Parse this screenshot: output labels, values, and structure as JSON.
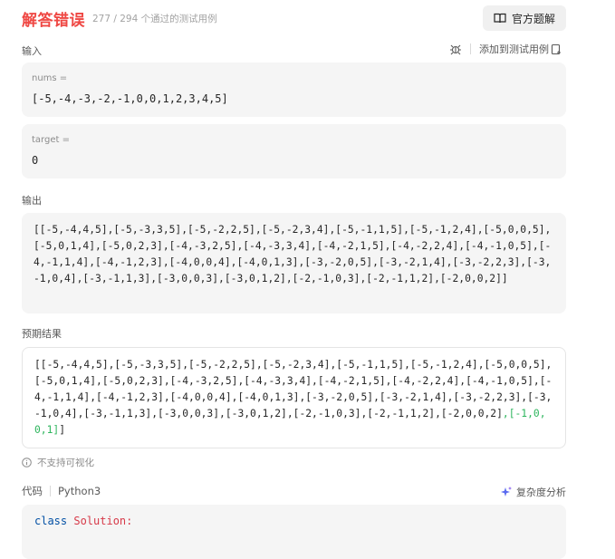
{
  "header": {
    "verdict": "解答错误",
    "passed_text": "277 / 294 个通过的测试用例",
    "official_button": "官方题解"
  },
  "input": {
    "label": "输入",
    "add_testcase": "添加到测试用例",
    "params": [
      {
        "name": "nums =",
        "value": "[-5,-4,-3,-2,-1,0,0,1,2,3,4,5]"
      },
      {
        "name": "target =",
        "value": "0"
      }
    ]
  },
  "output": {
    "label": "输出",
    "value": "[[-5,-4,4,5],[-5,-3,3,5],[-5,-2,2,5],[-5,-2,3,4],[-5,-1,1,5],[-5,-1,2,4],[-5,0,0,5],[-5,0,1,4],[-5,0,2,3],[-4,-3,2,5],[-4,-3,3,4],[-4,-2,1,5],[-4,-2,2,4],[-4,-1,0,5],[-4,-1,1,4],[-4,-1,2,3],[-4,0,0,4],[-4,0,1,3],[-3,-2,0,5],[-3,-2,1,4],[-3,-2,2,3],[-3,-1,0,4],[-3,-1,1,3],[-3,0,0,3],[-3,0,1,2],[-2,-1,0,3],[-2,-1,1,2],[-2,0,0,2]]"
  },
  "expected": {
    "label": "预期结果",
    "value_common": "[[-5,-4,4,5],[-5,-3,3,5],[-5,-2,2,5],[-5,-2,3,4],[-5,-1,1,5],[-5,-1,2,4],[-5,0,0,5],[-5,0,1,4],[-5,0,2,3],[-4,-3,2,5],[-4,-3,3,4],[-4,-2,1,5],[-4,-2,2,4],[-4,-1,0,5],[-4,-1,1,4],[-4,-1,2,3],[-4,0,0,4],[-4,0,1,3],[-3,-2,0,5],[-3,-2,1,4],[-3,-2,2,3],[-3,-1,0,4],[-3,-1,1,3],[-3,0,0,3],[-3,0,1,2],[-2,-1,0,3],[-2,-1,1,2],[-2,0,0,2]",
    "value_extra": ",[-1,0,0,1]",
    "value_close": "]"
  },
  "note": "不支持可视化",
  "code": {
    "tab_label": "代码",
    "language": "Python3",
    "complexity_label": "复杂度分析",
    "line_keyword": "class",
    "line_name": "Solution:"
  },
  "colors": {
    "error": "#ef4743",
    "diff_green": "#2db55d",
    "panel_bg": "#f5f5f5"
  }
}
